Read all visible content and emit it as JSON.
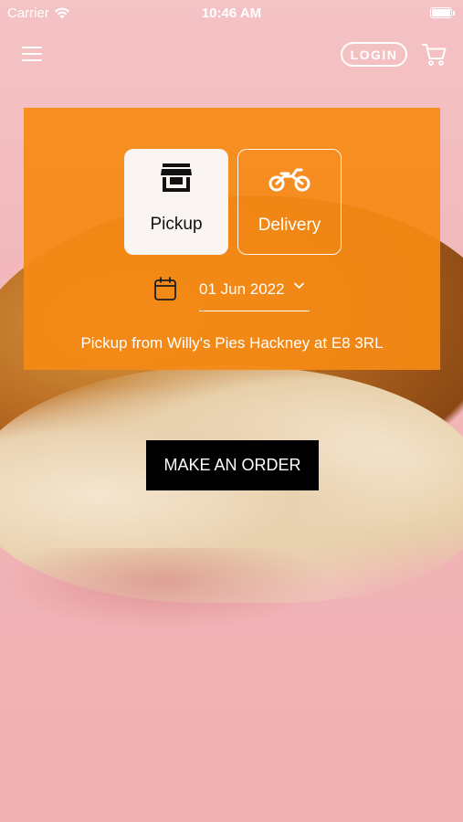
{
  "status_bar": {
    "carrier": "Carrier",
    "time": "10:46 AM"
  },
  "nav": {
    "menu_icon": "menu-icon",
    "login_label": "LOGIN",
    "cart_icon": "cart-icon"
  },
  "order_mode": {
    "options": [
      {
        "label": "Pickup",
        "icon": "store-icon",
        "selected": true
      },
      {
        "label": "Delivery",
        "icon": "motorbike-icon",
        "selected": false
      }
    ]
  },
  "date": {
    "value": "01 Jun 2022",
    "icon": "calendar-icon"
  },
  "pickup_info": "Pickup from Willy's Pies Hackney at E8 3RL",
  "order_button_label": "MAKE AN ORDER",
  "colors": {
    "accent": "#f58a14",
    "background": "#f2b8bb",
    "button": "#000000"
  }
}
